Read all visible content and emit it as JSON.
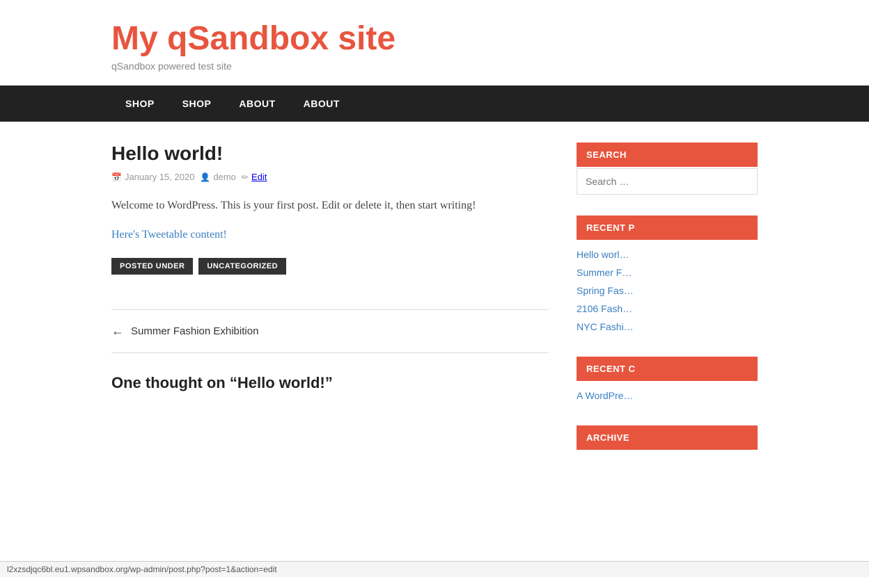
{
  "site": {
    "title": "My qSandbox site",
    "tagline": "qSandbox powered test site"
  },
  "nav": {
    "items": [
      {
        "label": "SHOP",
        "href": "#"
      },
      {
        "label": "SHOP",
        "href": "#"
      },
      {
        "label": "ABOUT",
        "href": "#"
      },
      {
        "label": "ABOUT",
        "href": "#"
      }
    ]
  },
  "post": {
    "title": "Hello world!",
    "date": "January 15, 2020",
    "author": "demo",
    "edit_label": "Edit",
    "content": "Welcome to WordPress. This is your first post. Edit or delete it, then start writing!",
    "tweetable_link": "Here's Tweetable content!",
    "posted_under_label": "POSTED UNDER",
    "category": "UNCATEGORIZED"
  },
  "post_nav": {
    "prev_label": "Summer Fashion Exhibition"
  },
  "comments": {
    "title": "One thought on “Hello world!”"
  },
  "sidebar": {
    "search_placeholder": "Search …",
    "search_widget_title": "SEARCH",
    "recent_posts_title": "RECENT P",
    "recent_posts": [
      {
        "label": "Hello worl…"
      },
      {
        "label": "Summer F…"
      },
      {
        "label": "Spring Fas…"
      },
      {
        "label": "2106 Fash…"
      },
      {
        "label": "NYC Fashi…"
      }
    ],
    "recent_comments_title": "RECENT C",
    "recent_comments": [
      {
        "label": "A WordPre…"
      }
    ],
    "archives_title": "ARCHIVE"
  },
  "status_bar": {
    "url": "l2xzsdjqc6bl.eu1.wpsandbox.org/wp-admin/post.php?post=1&action=edit"
  }
}
